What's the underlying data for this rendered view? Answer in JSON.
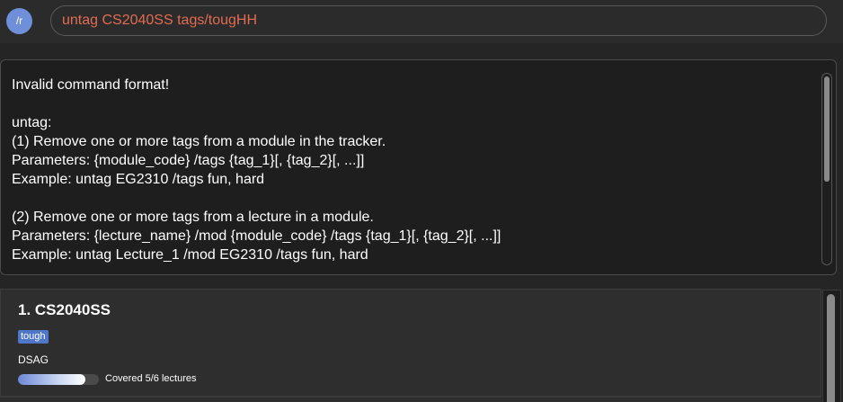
{
  "app": {
    "logo_text": "/r"
  },
  "command": {
    "value": "untag CS2040SS tags/tougHH"
  },
  "result": {
    "text": "Invalid command format!\n\nuntag:\n(1) Remove one or more tags from a module in the tracker.\nParameters: {module_code} /tags {tag_1}[, {tag_2}[, ...]]\nExample: untag EG2310 /tags fun, hard\n\n(2) Remove one or more tags from a lecture in a module.\nParameters: {lecture_name} /mod {module_code} /tags {tag_1}[, {tag_2}[, ...]]\nExample: untag Lecture_1 /mod EG2310 /tags fun, hard"
  },
  "modules": [
    {
      "index_title": "1.  CS2040SS",
      "tag": "tough",
      "name": "DSAG",
      "progress_fraction": 0.8333,
      "progress_text": "Covered 5/6 lectures"
    }
  ],
  "colors": {
    "accent": "#6f8fd8",
    "command_text": "#e06c52",
    "tag_bg": "#4f76c7"
  }
}
